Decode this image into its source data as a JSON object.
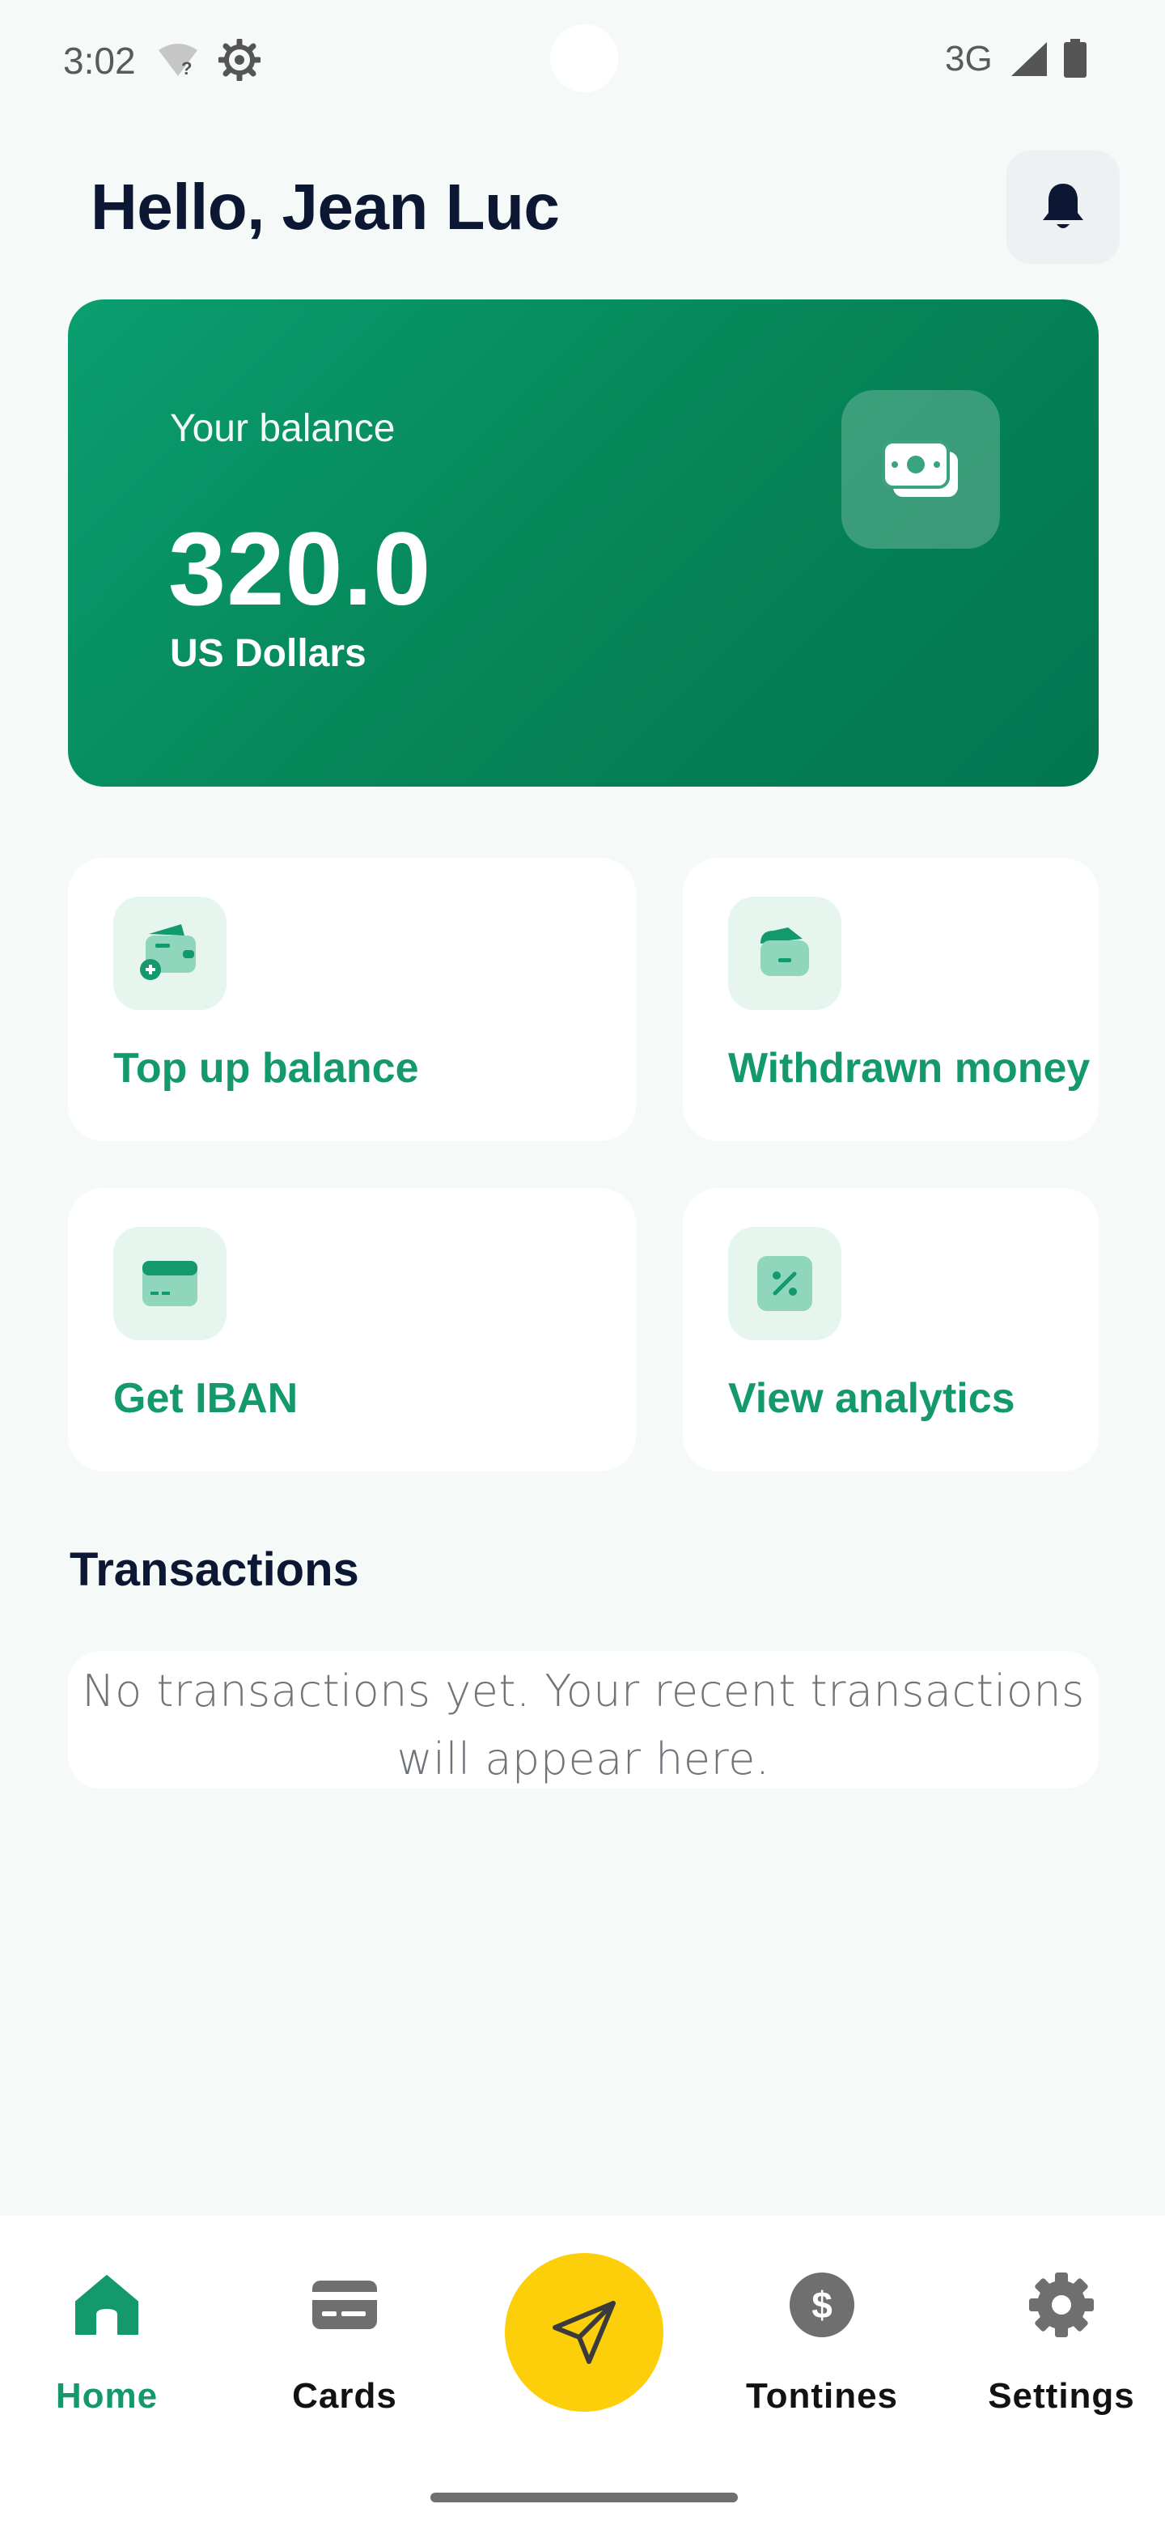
{
  "status_bar": {
    "time": "3:02",
    "network": "3G",
    "icons": [
      "wifi-question-icon",
      "gear-icon",
      "signal-icon",
      "battery-icon"
    ]
  },
  "header": {
    "greeting": "Hello, Jean Luc",
    "notification_icon": "bell-icon"
  },
  "balance": {
    "label": "Your balance",
    "amount": "320.0",
    "currency": "US Dollars",
    "icon": "cash-icon"
  },
  "actions": [
    {
      "label": "Top up balance",
      "icon": "wallet-add-icon"
    },
    {
      "label": "Withdrawn money",
      "icon": "wallet-withdraw-icon"
    },
    {
      "label": "Get IBAN",
      "icon": "card-icon"
    },
    {
      "label": "View analytics",
      "icon": "percent-icon"
    }
  ],
  "transactions": {
    "title": "Transactions",
    "empty_text": "No transactions yet. Your recent transactions will appear here."
  },
  "nav": {
    "items": [
      {
        "label": "Home",
        "icon": "home-icon",
        "active": true
      },
      {
        "label": "Cards",
        "icon": "credit-card-icon",
        "active": false
      },
      {
        "label": "Tontines",
        "icon": "dollar-circle-icon",
        "active": false
      },
      {
        "label": "Settings",
        "icon": "settings-gear-icon",
        "active": false
      }
    ],
    "fab_icon": "send-icon"
  },
  "colors": {
    "accent": "#13996b",
    "card_gradient_start": "#0a9e6f",
    "card_gradient_end": "#017650",
    "fab": "#fdcf0b",
    "text_dark": "#0c1733",
    "background": "#f5faf8"
  }
}
